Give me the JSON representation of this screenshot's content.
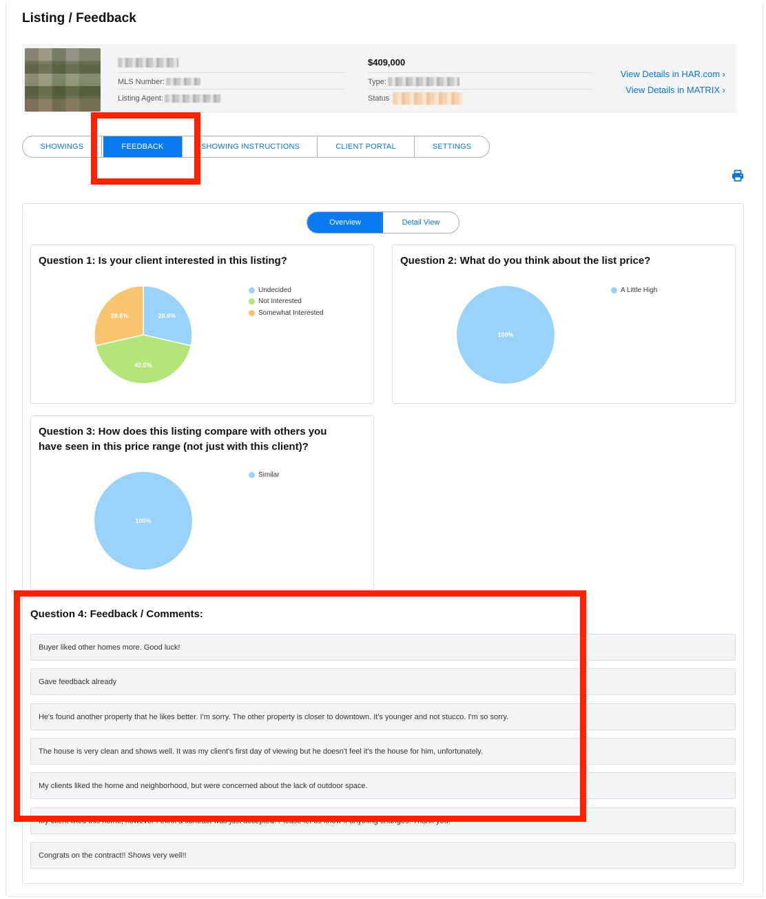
{
  "page": {
    "title": "Listing / Feedback"
  },
  "listing": {
    "price": "$409,000",
    "mls_label": "MLS Number:",
    "agent_label": "Listing Agent:",
    "type_label": "Type:",
    "status_label": "Status",
    "links": [
      "View Details in HAR.com ›",
      "View Details in MATRIX ›"
    ]
  },
  "tabs": [
    {
      "label": "SHOWINGS",
      "active": false
    },
    {
      "label": "FEEDBACK",
      "active": true
    },
    {
      "label": "SHOWING INSTRUCTIONS",
      "active": false
    },
    {
      "label": "CLIENT PORTAL",
      "active": false
    },
    {
      "label": "SETTINGS",
      "active": false
    }
  ],
  "view_toggle": {
    "overview": "Overview",
    "detail": "Detail View",
    "selected": "Overview"
  },
  "icons": {
    "print": "printer-icon"
  },
  "colors": {
    "accent": "#0a7cf0",
    "undecided": "#99d3fa",
    "not_interested": "#b3e57a",
    "somewhat_interested": "#f8c56e",
    "annotation": "#ff2200"
  },
  "questions": [
    {
      "title": "Question 1: Is your client interested in this listing?",
      "chart_data": {
        "type": "pie",
        "categories": [
          "Undecided",
          "Not Interested",
          "Somewhat Interested"
        ],
        "values": [
          28.6,
          42.9,
          28.6
        ],
        "labels": [
          "28.6%",
          "42.9%",
          "28.6%"
        ],
        "colors": [
          "#99d3fa",
          "#b3e57a",
          "#f8c56e"
        ],
        "legend": "right"
      }
    },
    {
      "title": "Question 2: What do you think about the list price?",
      "chart_data": {
        "type": "pie",
        "categories": [
          "A Little High"
        ],
        "values": [
          100
        ],
        "labels": [
          "100%"
        ],
        "colors": [
          "#99d3fa"
        ],
        "legend": "right"
      }
    },
    {
      "title": "Question 3: How does this listing compare with others you have seen in this price range (not just with this client)?",
      "chart_data": {
        "type": "pie",
        "categories": [
          "Similar"
        ],
        "values": [
          100
        ],
        "labels": [
          "100%"
        ],
        "colors": [
          "#99d3fa"
        ],
        "legend": "right"
      }
    }
  ],
  "feedback": {
    "title": "Question 4: Feedback / Comments:",
    "comments": [
      "Buyer liked other homes more. Good luck!",
      "Gave feedback already",
      "He's found another property that he likes better. I'm sorry. The other property is closer to downtown. It's younger and not stucco. I'm so sorry.",
      "The house is very clean and shows well. It was my client's first day of viewing but he doesn't feel it's the house for him, unfortunately.",
      "My clients liked the home and neighborhood, but were concerned about the lack of outdoor space.",
      "My client liked this home, however I think a contract was just accepted. Please let us know if anything changes. Thank you!",
      "Congrats on the contract!! Shows very well!!"
    ]
  }
}
